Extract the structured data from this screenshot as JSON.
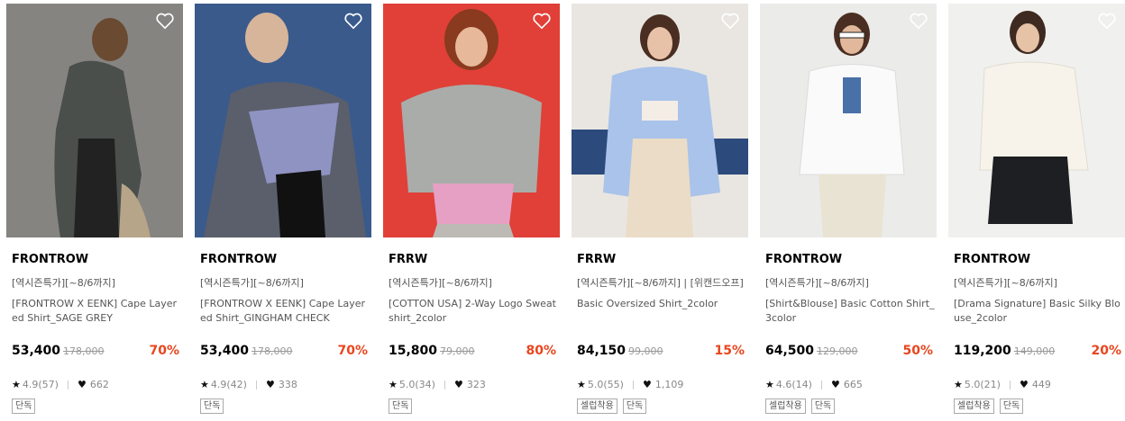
{
  "products": [
    {
      "brand": "FRONTROW",
      "promo": "[역시즌특가][~8/6까지]",
      "title": "[FRONTROW X EENK] Cape Layered Shirt_SAGE GREY",
      "price": "53,400",
      "original_price": "178,000",
      "discount": "70%",
      "rating": "4.9(57)",
      "likes": "662",
      "tags": [
        "단독"
      ],
      "bg_color": "#8a8784",
      "wishlist_icon": "heart-outline-icon"
    },
    {
      "brand": "FRONTROW",
      "promo": "[역시즌특가][~8/6까지]",
      "title": "[FRONTROW X EENK] Cape Layered Shirt_GINGHAM CHECK",
      "price": "53,400",
      "original_price": "178,000",
      "discount": "70%",
      "rating": "4.9(42)",
      "likes": "338",
      "tags": [
        "단독"
      ],
      "bg_color": "#3a5a8c",
      "wishlist_icon": "heart-outline-icon"
    },
    {
      "brand": "FRRW",
      "promo": "[역시즌특가][~8/6까지]",
      "title": "[COTTON USA] 2-Way Logo Sweatshirt_2color",
      "price": "15,800",
      "original_price": "79,000",
      "discount": "80%",
      "rating": "5.0(34)",
      "likes": "323",
      "tags": [
        "단독"
      ],
      "bg_color": "#e04038",
      "wishlist_icon": "heart-outline-icon"
    },
    {
      "brand": "FRRW",
      "promo": "[역시즌특가][~8/6까지] | [위캔드오프]",
      "title": "Basic Oversized Shirt_2color",
      "price": "84,150",
      "original_price": "99,000",
      "discount": "15%",
      "rating": "5.0(55)",
      "likes": "1,109",
      "tags": [
        "셀럽착용",
        "단독"
      ],
      "bg_color": "#e9e6e1",
      "wishlist_icon": "heart-outline-icon"
    },
    {
      "brand": "FRONTROW",
      "promo": "[역시즌특가][~8/6까지]",
      "title": "[Shirt&Blouse] Basic Cotton Shirt_3color",
      "price": "64,500",
      "original_price": "129,000",
      "discount": "50%",
      "rating": "4.6(14)",
      "likes": "665",
      "tags": [
        "셀럽착용",
        "단독"
      ],
      "bg_color": "#ebebe9",
      "wishlist_icon": "heart-outline-icon"
    },
    {
      "brand": "FRONTROW",
      "promo": "[역시즌특가][~8/6까지]",
      "title": "[Drama Signature] Basic Silky Blouse_2color",
      "price": "119,200",
      "original_price": "149,000",
      "discount": "20%",
      "rating": "5.0(21)",
      "likes": "449",
      "tags": [
        "셀럽착용",
        "단독"
      ],
      "bg_color": "#f0f0ef",
      "wishlist_icon": "heart-outline-icon"
    }
  ],
  "colors": {
    "discount": "#e8461e",
    "star": "#111111",
    "muted": "#888888"
  }
}
